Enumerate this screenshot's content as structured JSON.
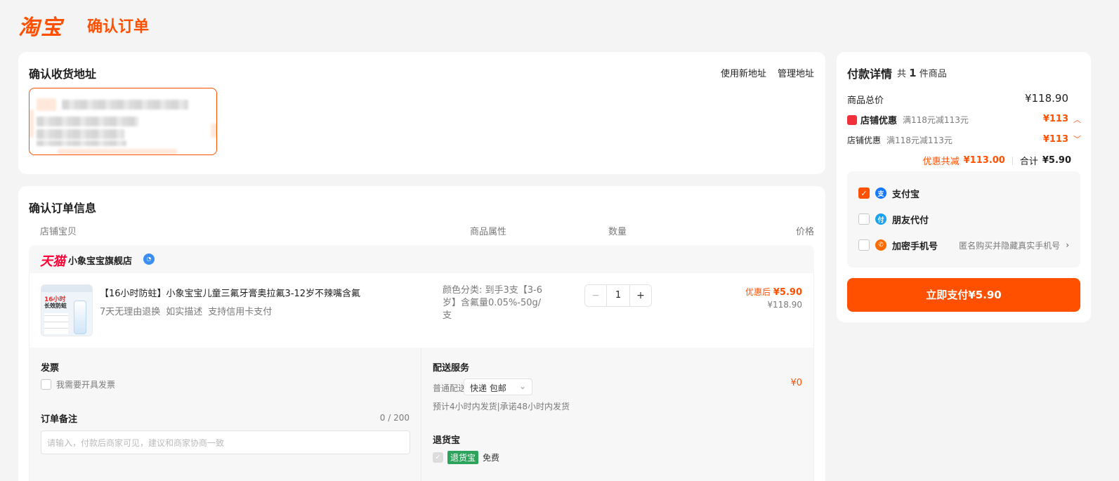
{
  "header": {
    "logo": "淘宝",
    "title": "确认订单"
  },
  "address": {
    "title": "确认收货地址",
    "use_new": "使用新地址",
    "manage": "管理地址"
  },
  "order": {
    "title": "确认订单信息",
    "columns": {
      "item": "店铺宝贝",
      "attr": "商品属性",
      "qty": "数量",
      "price": "价格"
    },
    "store": {
      "brand": "天猫",
      "name": "小象宝宝旗舰店"
    },
    "item": {
      "title": "【16小时防蛀】小象宝宝儿童三氟牙膏奥拉氟3-12岁不辣嘴含氟",
      "tags": [
        "7天无理由退换",
        "如实描述",
        "支持信用卡支付"
      ],
      "thumb_t1": "16小时",
      "thumb_t2": "长效防蛀",
      "attr": "颜色分类: 到手3支【3-6岁】含氟量0.05%-50g/支",
      "qty": "1",
      "price_after_label": "优惠后",
      "price_after": "¥5.90",
      "price_orig": "¥118.90"
    },
    "invoice": {
      "title": "发票",
      "checkbox": "我需要开具发票"
    },
    "note": {
      "title": "订单备注",
      "count": "0 / 200",
      "placeholder": "请输入，付款后商家可见，建议和商家协商一致"
    },
    "delivery": {
      "title": "配送服务",
      "label": "普通配送",
      "option": "快递 包邮",
      "desc": "预计4小时内发货|承诺48小时内发货",
      "price": "¥0"
    },
    "tuihuo": {
      "title": "退货宝",
      "tag": "退货宝",
      "free": "免费"
    }
  },
  "payment": {
    "title": "付款详情",
    "count_prefix": "共",
    "count": "1",
    "count_suffix": "件商品",
    "total_label": "商品总价",
    "total": "¥118.90",
    "shop_discount_label": "店铺优惠",
    "shop_discount_desc": "满118元减113元",
    "shop_discount_val": "¥113",
    "shop_discount2_label": "店铺优惠",
    "shop_discount2_desc": "满118元减113元",
    "shop_discount2_val": "¥113",
    "saved_label": "优惠共减",
    "saved": "¥113.00",
    "sum_label": "合计",
    "sum": "¥5.90",
    "methods": [
      {
        "label": "支付宝",
        "checked": true
      },
      {
        "label": "朋友代付",
        "checked": false
      },
      {
        "label": "加密手机号",
        "checked": false,
        "hint": "匿名购买并隐藏真实手机号"
      }
    ],
    "pay_button": "立即支付¥5.90"
  },
  "colors": {
    "accent": "#ff5000",
    "tmall": "#ff0036",
    "tuihuo": "#2ea35c"
  }
}
